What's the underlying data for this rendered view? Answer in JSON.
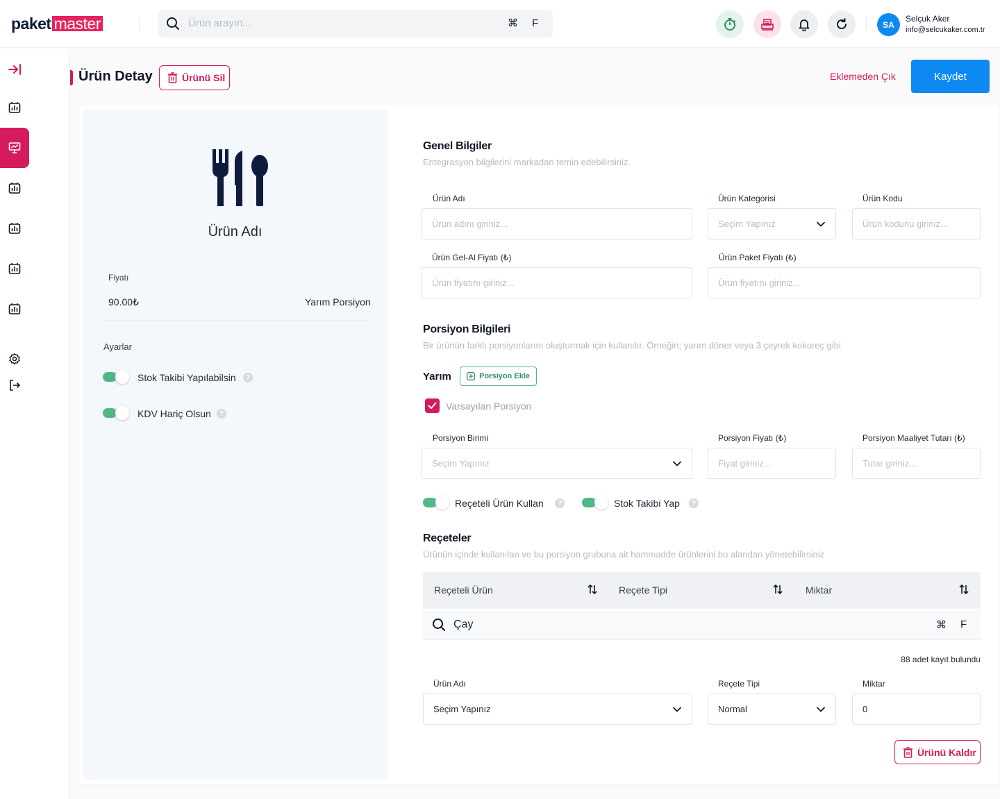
{
  "brand": {
    "part1": "pa",
    "part2": "ket",
    "part3": "master",
    "accent": "#d61a5e",
    "primary": "#0e89f2"
  },
  "search": {
    "placeholder": "Ürün arayın...",
    "shortcut_symbol": "⌘",
    "shortcut_key": "F"
  },
  "topbar_icons": [
    "timer-icon",
    "printer-icon",
    "bell-icon",
    "refresh-icon"
  ],
  "user": {
    "initials": "SA",
    "name": "Selçuk Aker",
    "email": "info@selcukaker.com.tr"
  },
  "sidebar": {
    "icons": [
      "collapse-icon",
      "chart-icon",
      "presentation-icon",
      "chart-icon",
      "chart-icon",
      "chart-icon",
      "chart-icon",
      "settings-icon",
      "logout-icon"
    ],
    "active_index": 2
  },
  "header": {
    "title": "Ürün Detay",
    "delete_label": "Ürünü Sil",
    "exit_label": "Eklemeden Çık",
    "save_label": "Kaydet"
  },
  "product_card": {
    "name": "Ürün Adı",
    "price_label": "Fiyatı",
    "price": "90.00₺",
    "portion": "Yarım Porsiyon",
    "settings_label": "Ayarlar",
    "toggles": [
      {
        "label": "Stok Takibi Yapılabilsin",
        "on": true
      },
      {
        "label": "KDV Hariç Olsun",
        "on": true
      }
    ]
  },
  "general": {
    "title": "Genel Bilgiler",
    "subtitle": "Entegrasyon bilgilerini markadan temin edebilirsiniz.",
    "fields": {
      "name": {
        "label": "Ürün Adı",
        "placeholder": "Ürün adını giriniz..."
      },
      "category": {
        "label": "Ürün Kategorisi",
        "placeholder": "Seçim Yapınız"
      },
      "code": {
        "label": "Ürün Kodu",
        "placeholder": "Ürün kodunu giriniz..."
      },
      "takeaway_price": {
        "label": "Ürün Gel-Al Fiyatı (₺)",
        "placeholder": "Ürün fiyatını giriniz..."
      },
      "package_price": {
        "label": "Ürün Paket Fiyatı (₺)",
        "placeholder": "Ürün fiyatını giriniz..."
      }
    }
  },
  "portion": {
    "title": "Porsiyon Bilgileri",
    "subtitle": "Bir ürünün farklı porsiyonlarını oluşturmak için kullanılır. Örneğin; yarım döner veya 3 çeyrek kokoreç gibi",
    "name": "Yarım",
    "add_label": "Porsiyon Ekle",
    "default_label": "Varsayılan Porsiyon",
    "default_checked": true,
    "fields": {
      "unit": {
        "label": "Porsiyon Birimi",
        "placeholder": "Seçim Yapınız"
      },
      "price": {
        "label": "Porsiyon Fiyatı (₺)",
        "placeholder": "Fiyat giriniz..."
      },
      "cost": {
        "label": "Porsiyon Maaliyet Tutarı (₺)",
        "placeholder": "Tutar giriniz..."
      }
    },
    "toggles": [
      {
        "label": "Reçeteli Ürün Kullan",
        "on": true
      },
      {
        "label": "Stok Takibi Yap",
        "on": true
      }
    ]
  },
  "recipes": {
    "title": "Reçeteler",
    "subtitle": "Ürünün içinde kullanılan ve bu porsiyon grubuna ait hammadde ürünlerini bu alandan yönetebilirsiniz",
    "columns": [
      "Reçeteli Ürün",
      "Reçete Tipi",
      "Miktar"
    ],
    "search_value": "Çay",
    "count_text": "88 adet kayıt bulundu",
    "row": {
      "product": {
        "label": "Ürün Adı",
        "value": "Seçim Yapınız"
      },
      "type": {
        "label": "Reçete Tipi",
        "value": "Normal"
      },
      "qty": {
        "label": "Miktar",
        "value": "0"
      }
    },
    "remove_label": "Ürünü Kaldır"
  }
}
